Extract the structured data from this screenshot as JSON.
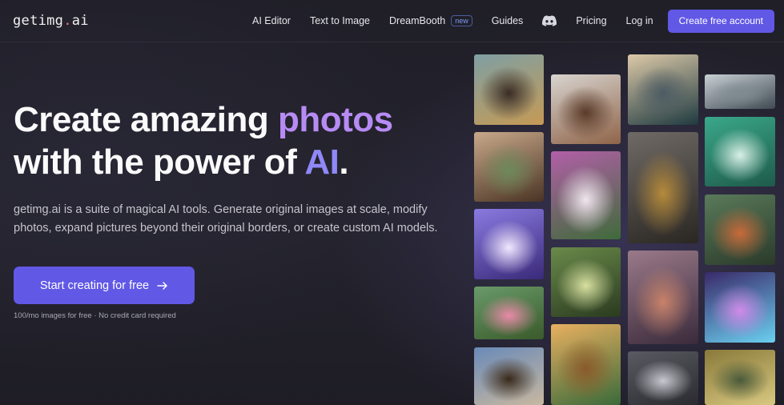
{
  "nav": {
    "logo_main": "getimg",
    "logo_dot": ".",
    "logo_tld": "ai",
    "links": [
      {
        "label": "AI Editor"
      },
      {
        "label": "Text to Image"
      },
      {
        "label": "DreamBooth",
        "badge": "new"
      },
      {
        "label": "Guides"
      },
      {
        "icon": "discord-icon"
      },
      {
        "label": "Pricing"
      },
      {
        "label": "Log in"
      }
    ],
    "cta_label": "Create free account"
  },
  "hero": {
    "title_part1": "Create amazing ",
    "title_highlight1": "photos",
    "title_part2": "with the power of ",
    "title_highlight2": "AI",
    "title_end": ".",
    "description": "getimg.ai is a suite of magical AI tools. Generate original images at scale, modify photos, expand pictures beyond their original borders, or create custom AI models.",
    "button_label": "Start creating for free",
    "button_icon": "arrow-right-icon",
    "note": "100/mo images for free · No credit card required"
  },
  "gallery": {
    "images": [
      {
        "name": "man-in-coat-portrait",
        "colors": [
          "#7f9fa3",
          "#3a2c24",
          "#c59a55"
        ]
      },
      {
        "name": "curly-hair-man-portrait",
        "colors": [
          "#d8d4d0",
          "#5a3a28",
          "#8f6448"
        ]
      },
      {
        "name": "stormy-sea-painting",
        "colors": [
          "#dcc9a8",
          "#4d5b63",
          "#1f3a40"
        ]
      },
      {
        "name": "cloudscape",
        "colors": [
          "#c8d0d4",
          "#7f8b92",
          "#3f4a52"
        ]
      },
      {
        "name": "cabin-bedroom-window",
        "colors": [
          "#c8a88a",
          "#6d8a5a",
          "#4a3424"
        ]
      },
      {
        "name": "fairy-woman-flowers",
        "colors": [
          "#b25fa8",
          "#f0e6ee",
          "#3f6b3a"
        ]
      },
      {
        "name": "golden-skull-sculpture",
        "colors": [
          "#6f6a66",
          "#b58a3a",
          "#2a2622"
        ]
      },
      {
        "name": "green-hair-anime-girl",
        "colors": [
          "#3aa88a",
          "#d8f0e6",
          "#1e5a4a"
        ]
      },
      {
        "name": "cosmic-cat",
        "colors": [
          "#8a7ae0",
          "#f0e8ff",
          "#3a2a7a"
        ]
      },
      {
        "name": "sunlit-forest",
        "colors": [
          "#6a8a4a",
          "#d8e0a0",
          "#2a3a20"
        ]
      },
      {
        "name": "koi-pond",
        "colors": [
          "#5a7a5a",
          "#c86a3a",
          "#2a3a2a"
        ]
      },
      {
        "name": "mushroom-forest",
        "colors": [
          "#9a7a8a",
          "#c8826a",
          "#3a2a3a"
        ]
      },
      {
        "name": "pink-roses-garden",
        "colors": [
          "#6a9a6a",
          "#e88aa8",
          "#3a5a2a"
        ]
      },
      {
        "name": "neon-hamster",
        "colors": [
          "#3a2a6a",
          "#d08ae8",
          "#6ad0f0"
        ]
      },
      {
        "name": "soldier-on-horse",
        "colors": [
          "#6a8ab8",
          "#3a2a1a",
          "#c8b8a0"
        ]
      },
      {
        "name": "mayan-pyramid",
        "colors": [
          "#e8b060",
          "#8a5a2a",
          "#3a6a3a"
        ]
      },
      {
        "name": "white-sneaker",
        "colors": [
          "#5a5a62",
          "#c8c8d0",
          "#2a2a30"
        ]
      },
      {
        "name": "ornate-gold-mask",
        "colors": [
          "#8a7a3a",
          "#4a5a3a",
          "#d8c880"
        ]
      }
    ]
  }
}
